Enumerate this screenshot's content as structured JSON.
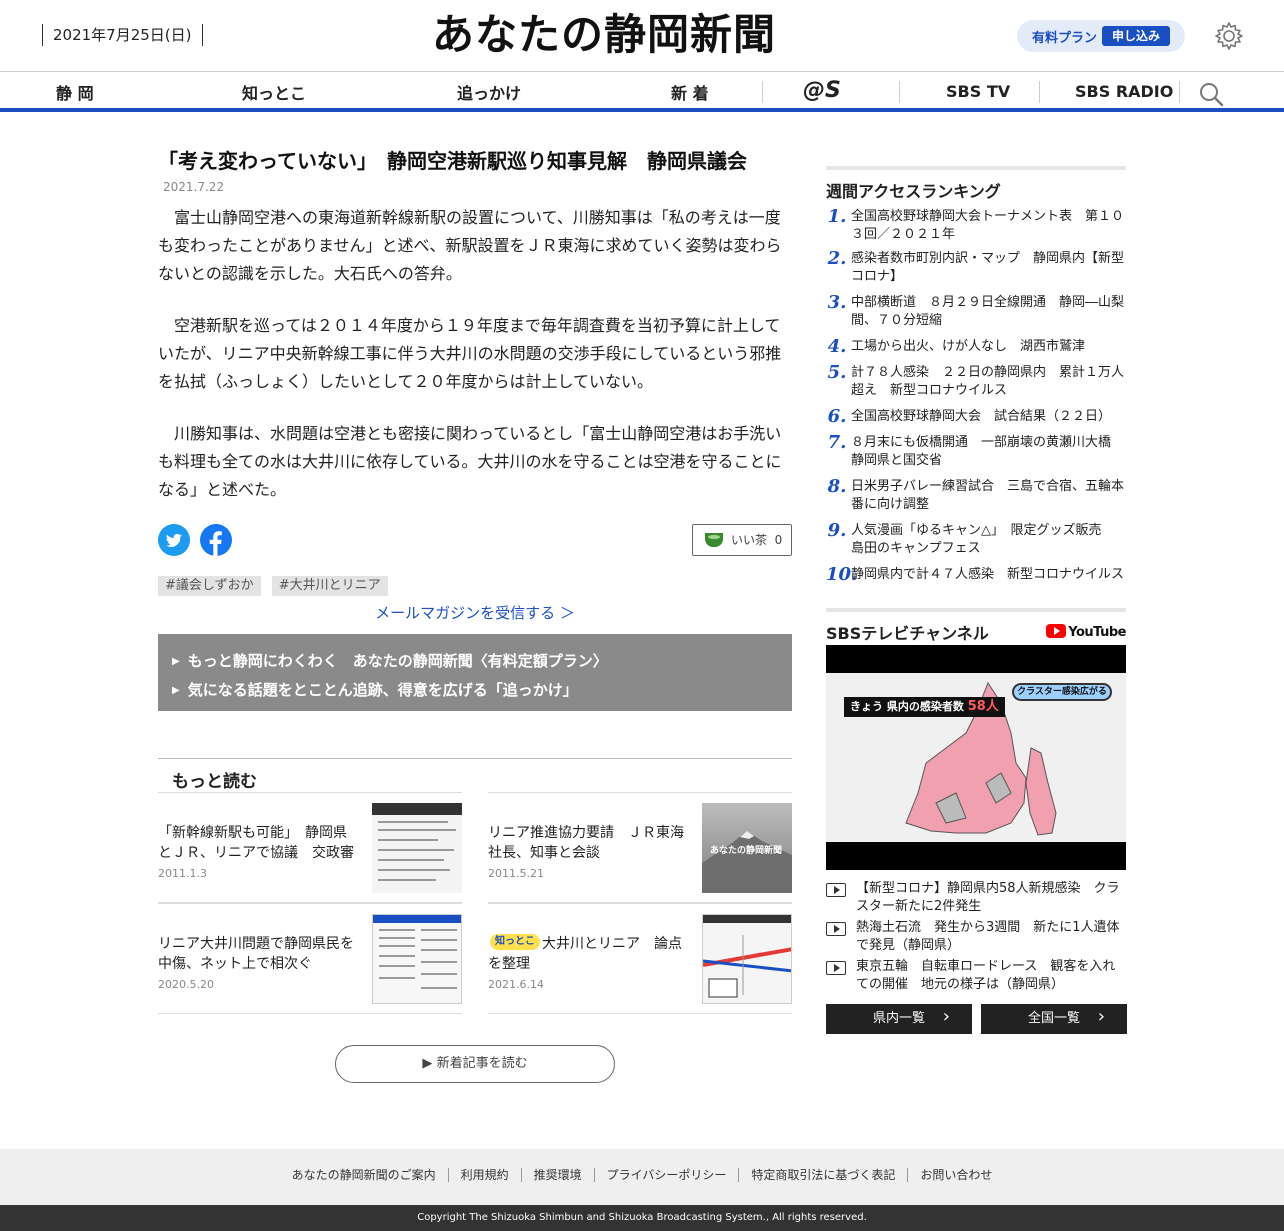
{
  "header": {
    "date": "2021年7月25日(日)",
    "logo": "あなたの静岡新聞",
    "plan_label": "有料プラン",
    "plan_button": "申し込み"
  },
  "nav": {
    "items": [
      "静 岡",
      "知っとこ",
      "追っかけ",
      "新 着"
    ],
    "logos": [
      "@S",
      "SBS TV",
      "SBS RADIO"
    ]
  },
  "article": {
    "title": "「考え変わっていない」　静岡空港新駅巡り知事見解　静岡県議会",
    "date": "2021.7.22",
    "paragraphs": [
      "　富士山静岡空港への東海道新幹線新駅の設置について、川勝知事は「私の考えは一度も変わったことがありません」と述べ、新駅設置をＪＲ東海に求めていく姿勢は変わらないとの認識を示した。大石氏への答弁。",
      "　空港新駅を巡っては２０１４年度から１９年度まで毎年調査費を当初予算に計上していたが、リニア中央新幹線工事に伴う大井川の水問題の交渉手段にしているという邪推を払拭（ふっしょく）したいとして２０年度からは計上していない。",
      "　川勝知事は、水問題は空港とも密接に関わっているとし「富士山静岡空港はお手洗いも料理も全ての水は大井川に依存している。大井川の水を守ることは空港を守ることになる」と述べた。"
    ],
    "tea_label": "いい茶",
    "tea_count": "0",
    "tags": [
      "#議会しずおか",
      "#大井川とリニア"
    ],
    "mail_link": "メールマガジンを受信する ＞",
    "promo": [
      "もっと静岡にわくわく　あなたの静岡新聞〈有料定額プラン〉",
      "気になる話題をとことん追跡、得意を広げる「追っかけ」"
    ]
  },
  "more": {
    "heading": "もっと読む",
    "cards": [
      {
        "title": "「新幹線新駅も可能」　静岡県とＪＲ、リニアで協議　交政審",
        "date": "2011.1.3"
      },
      {
        "title": "リニア推進協力要請　ＪＲ東海社長、知事と会談",
        "date": "2011.5.21",
        "thumb_text": "あなたの静岡新聞"
      },
      {
        "title": "リニア大井川問題で静岡県民を中傷、ネット上で相次ぐ",
        "date": "2020.5.20"
      },
      {
        "title": "大井川とリニア　論点を整理",
        "date": "2021.6.14",
        "badge": "知っとこ"
      }
    ],
    "read_more": "新着記事を読む"
  },
  "ranking": {
    "heading": "週間アクセスランキング",
    "items": [
      {
        "no": "1.",
        "text": "全国高校野球静岡大会トーナメント表　第１０３回／２０２１年"
      },
      {
        "no": "2.",
        "text": "感染者数市町別内訳・マップ　静岡県内【新型コロナ】"
      },
      {
        "no": "3.",
        "text": "中部横断道　８月２９日全線開通　静岡―山梨間、７０分短縮"
      },
      {
        "no": "4.",
        "text": "工場から出火、けが人なし　湖西市鷲津"
      },
      {
        "no": "5.",
        "text": "計７８人感染　２２日の静岡県内　累計１万人超え　新型コロナウイルス"
      },
      {
        "no": "6.",
        "text": "全国高校野球静岡大会　試合結果（２２日）"
      },
      {
        "no": "7.",
        "text": "８月末にも仮橋開通　一部崩壊の黄瀬川大橋　静岡県と国交省"
      },
      {
        "no": "8.",
        "text": "日米男子バレー練習試合　三島で合宿、五輪本番に向け調整"
      },
      {
        "no": "9.",
        "text": "人気漫画「ゆるキャン△」　限定グッズ販売　島田のキャンプフェス"
      },
      {
        "no": "10.",
        "text": "静岡県内で計４７人感染　新型コロナウイルス"
      }
    ]
  },
  "sbs": {
    "heading": "SBSテレビチャンネル",
    "youtube": "YouTube",
    "video_label": "きょう 県内の感染者数",
    "video_count": "58人",
    "video_cluster": "クラスター感染広がる",
    "videos": [
      "【新型コロナ】静岡県内58人新規感染　クラスター新たに2件発生",
      "熱海土石流　発生から3週間　新たに1人遺体で発見（静岡県）",
      "東京五輪　自転車ロードレース　観客を入れての開催　地元の様子は（静岡県）"
    ],
    "btn_pref": "県内一覧",
    "btn_national": "全国一覧"
  },
  "footer": {
    "links": [
      "あなたの静岡新聞のご案内",
      "利用規約",
      "推奨環境",
      "プライバシーポリシー",
      "特定商取引法に基づく表記",
      "お問い合わせ"
    ],
    "copyright": "Copyright The Shizuoka Shimbun and Shizuoka Broadcasting System., All rights reserved."
  },
  "colors": {
    "accent": "#1a4fc4",
    "promo_bg": "#8a8a8a",
    "footer_bg": "#efefef",
    "copyright_bg": "#333333"
  },
  "icons": [
    "gear-icon",
    "search-icon",
    "twitter-icon",
    "facebook-icon",
    "tea-icon",
    "youtube-icon",
    "video-icon"
  ]
}
